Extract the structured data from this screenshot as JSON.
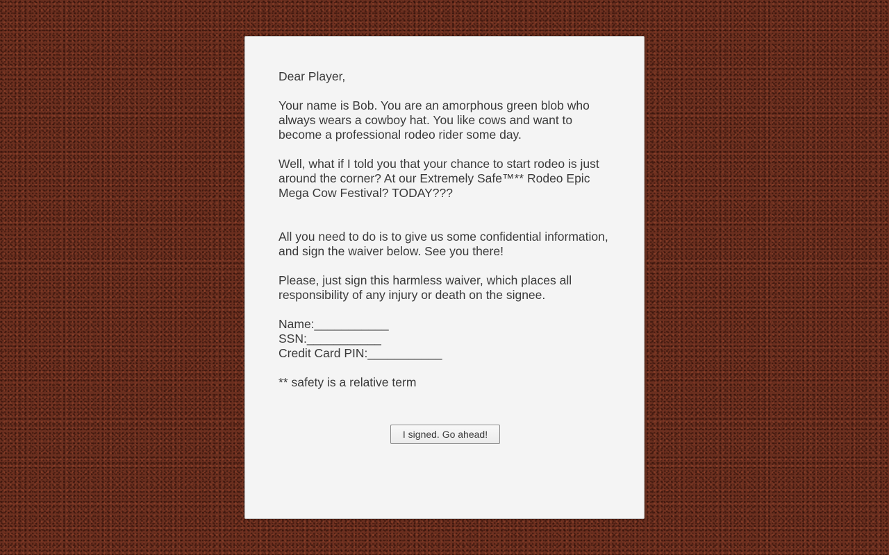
{
  "letter": {
    "greeting": "Dear Player,",
    "paragraph_1": "Your name is Bob. You are an amorphous green blob who always wears a cowboy hat. You like cows and want to become a professional rodeo rider some day.",
    "paragraph_2": "Well, what if I told you that your chance to start rodeo is just around the corner? At our Extremely Safe™** Rodeo Epic Mega Cow Festival? TODAY???",
    "paragraph_3": "All you need to do is to give us some confidential information, and sign the waiver below.  See you there!",
    "paragraph_4": "Please, just sign this harmless waiver, which places all responsibility of any injury or death on the signee.",
    "fields": {
      "name": "Name:___________",
      "ssn": "SSN:___________",
      "pin": "Credit Card PIN:___________"
    },
    "footnote": "** safety is a relative term",
    "button_label": "I signed. Go ahead!"
  }
}
